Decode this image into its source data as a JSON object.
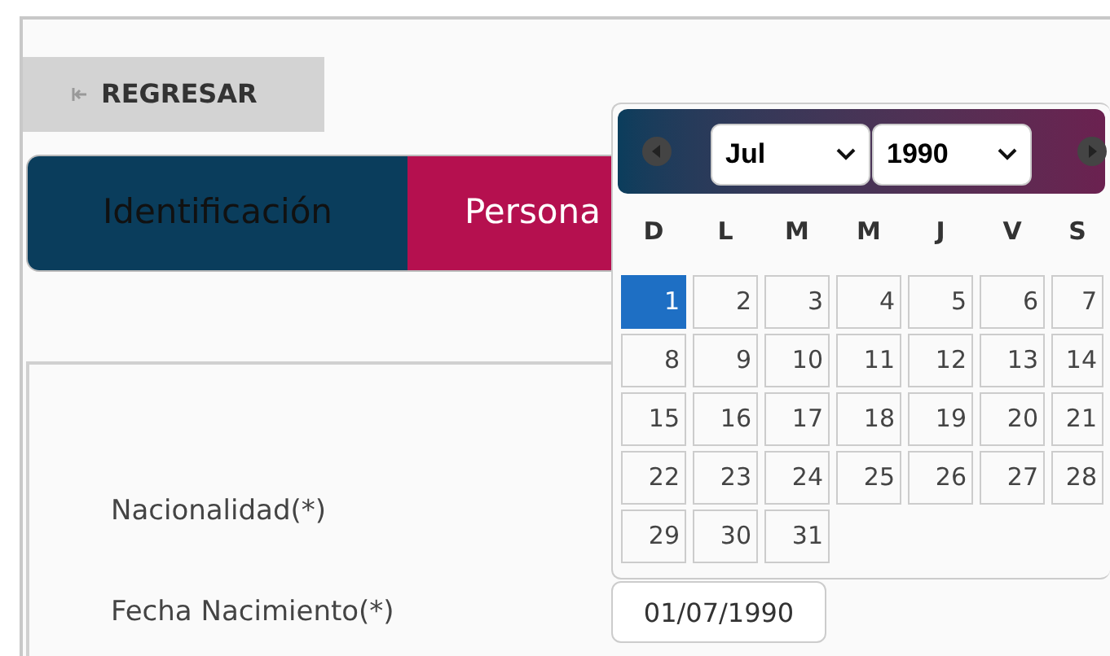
{
  "back_button": {
    "label": "REGRESAR"
  },
  "tabs": [
    {
      "label": "Identificación",
      "selected": true
    },
    {
      "label": "Persona",
      "selected": false
    }
  ],
  "fields": [
    {
      "label": "Nacionalidad(*)"
    },
    {
      "label": "Fecha Nacimiento(*)",
      "value": "01/07/1990"
    }
  ],
  "datepicker": {
    "month": "Jul",
    "year": "1990",
    "weekdays": [
      "D",
      "L",
      "M",
      "M",
      "J",
      "V",
      "S"
    ],
    "days": [
      {
        "label": "1",
        "selected": true
      },
      {
        "label": "2",
        "selected": false
      },
      {
        "label": "3",
        "selected": false
      },
      {
        "label": "4",
        "selected": false
      },
      {
        "label": "5",
        "selected": false
      },
      {
        "label": "6",
        "selected": false
      },
      {
        "label": "7",
        "selected": false
      },
      {
        "label": "8",
        "selected": false
      },
      {
        "label": "9",
        "selected": false
      },
      {
        "label": "10",
        "selected": false
      },
      {
        "label": "11",
        "selected": false
      },
      {
        "label": "12",
        "selected": false
      },
      {
        "label": "13",
        "selected": false
      },
      {
        "label": "14",
        "selected": false
      },
      {
        "label": "15",
        "selected": false
      },
      {
        "label": "16",
        "selected": false
      },
      {
        "label": "17",
        "selected": false
      },
      {
        "label": "18",
        "selected": false
      },
      {
        "label": "19",
        "selected": false
      },
      {
        "label": "20",
        "selected": false
      },
      {
        "label": "21",
        "selected": false
      },
      {
        "label": "22",
        "selected": false
      },
      {
        "label": "23",
        "selected": false
      },
      {
        "label": "24",
        "selected": false
      },
      {
        "label": "25",
        "selected": false
      },
      {
        "label": "26",
        "selected": false
      },
      {
        "label": "27",
        "selected": false
      },
      {
        "label": "28",
        "selected": false
      },
      {
        "label": "29",
        "selected": false
      },
      {
        "label": "30",
        "selected": false
      },
      {
        "label": "31",
        "selected": false
      }
    ]
  }
}
